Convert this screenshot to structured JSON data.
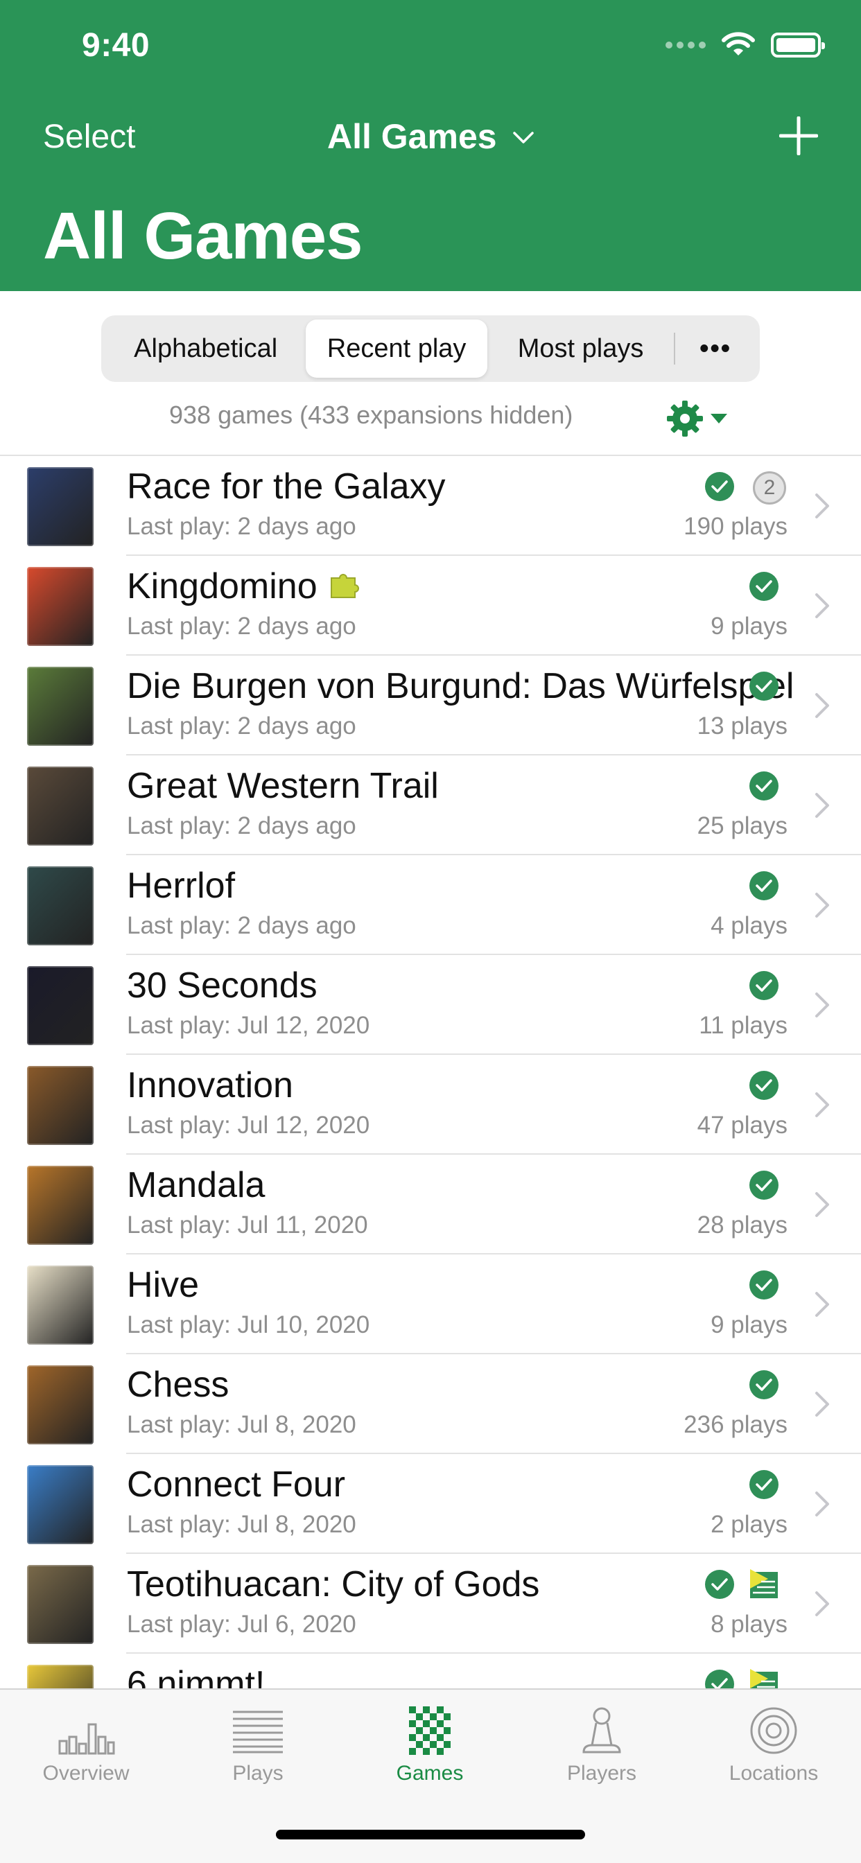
{
  "status_bar": {
    "time": "9:40"
  },
  "nav": {
    "select_label": "Select",
    "dropdown_title": "All Games",
    "large_title": "All Games"
  },
  "sort_tabs": [
    {
      "label": "Alphabetical",
      "selected": false
    },
    {
      "label": "Recent play",
      "selected": true
    },
    {
      "label": "Most plays",
      "selected": false
    },
    {
      "label": "•••",
      "selected": false
    }
  ],
  "summary": "938 games (433 expansions hidden)",
  "colors": {
    "brand": "#2a9457",
    "check": "#2f8f57",
    "accent": "#1a8b44"
  },
  "games": [
    {
      "name": "Race for the Galaxy",
      "last_play": "Last play: 2 days ago",
      "plays": "190 plays",
      "badge": "2",
      "icons": [
        "check-icon"
      ],
      "thumb_color": "#2c3e6b"
    },
    {
      "name": "Kingdomino",
      "last_play": "Last play: 2 days ago",
      "plays": "9 plays",
      "icons": [
        "puzzle-icon",
        "check-icon"
      ],
      "thumb_color": "#d84a2d"
    },
    {
      "name": "Die Burgen von Burgund: Das Würfelspiel",
      "last_play": "Last play: 2 days ago",
      "plays": "13 plays",
      "icons": [
        "check-icon"
      ],
      "thumb_color": "#5b7c3a"
    },
    {
      "name": "Great Western Trail",
      "last_play": "Last play: 2 days ago",
      "plays": "25 plays",
      "icons": [
        "check-icon"
      ],
      "thumb_color": "#5a4a3a"
    },
    {
      "name": "Herrlof",
      "last_play": "Last play: 2 days ago",
      "plays": "4 plays",
      "icons": [
        "check-icon"
      ],
      "thumb_color": "#2f4a4a"
    },
    {
      "name": "30 Seconds",
      "last_play": "Last play: Jul 12, 2020",
      "plays": "11 plays",
      "icons": [
        "check-icon"
      ],
      "thumb_color": "#1a1a2a"
    },
    {
      "name": "Innovation",
      "last_play": "Last play: Jul 12, 2020",
      "plays": "47 plays",
      "icons": [
        "check-icon"
      ],
      "thumb_color": "#8a5a2a"
    },
    {
      "name": "Mandala",
      "last_play": "Last play: Jul 11, 2020",
      "plays": "28 plays",
      "icons": [
        "check-icon"
      ],
      "thumb_color": "#b8762a"
    },
    {
      "name": "Hive",
      "last_play": "Last play: Jul 10, 2020",
      "plays": "9 plays",
      "icons": [
        "check-icon"
      ],
      "thumb_color": "#e8e0c8"
    },
    {
      "name": "Chess",
      "last_play": "Last play: Jul 8, 2020",
      "plays": "236 plays",
      "icons": [
        "check-icon"
      ],
      "thumb_color": "#a0662a"
    },
    {
      "name": "Connect Four",
      "last_play": "Last play: Jul 8, 2020",
      "plays": "2 plays",
      "icons": [
        "check-icon"
      ],
      "thumb_color": "#3a7ec8"
    },
    {
      "name": "Teotihuacan: City of Gods",
      "last_play": "Last play: Jul 6, 2020",
      "plays": "8 plays",
      "icons": [
        "check-icon",
        "flag-icon"
      ],
      "thumb_color": "#7a6a4a"
    },
    {
      "name": "6 nimmt!",
      "last_play": "",
      "plays": "",
      "icons": [
        "check-icon",
        "flag-icon"
      ],
      "thumb_color": "#e8c83a"
    }
  ],
  "tabs": [
    {
      "label": "Overview",
      "icon": "chart-icon",
      "active": false
    },
    {
      "label": "Plays",
      "icon": "list-icon",
      "active": false
    },
    {
      "label": "Games",
      "icon": "checkerboard-icon",
      "active": true
    },
    {
      "label": "Players",
      "icon": "pawn-icon",
      "active": false
    },
    {
      "label": "Locations",
      "icon": "target-icon",
      "active": false
    }
  ]
}
